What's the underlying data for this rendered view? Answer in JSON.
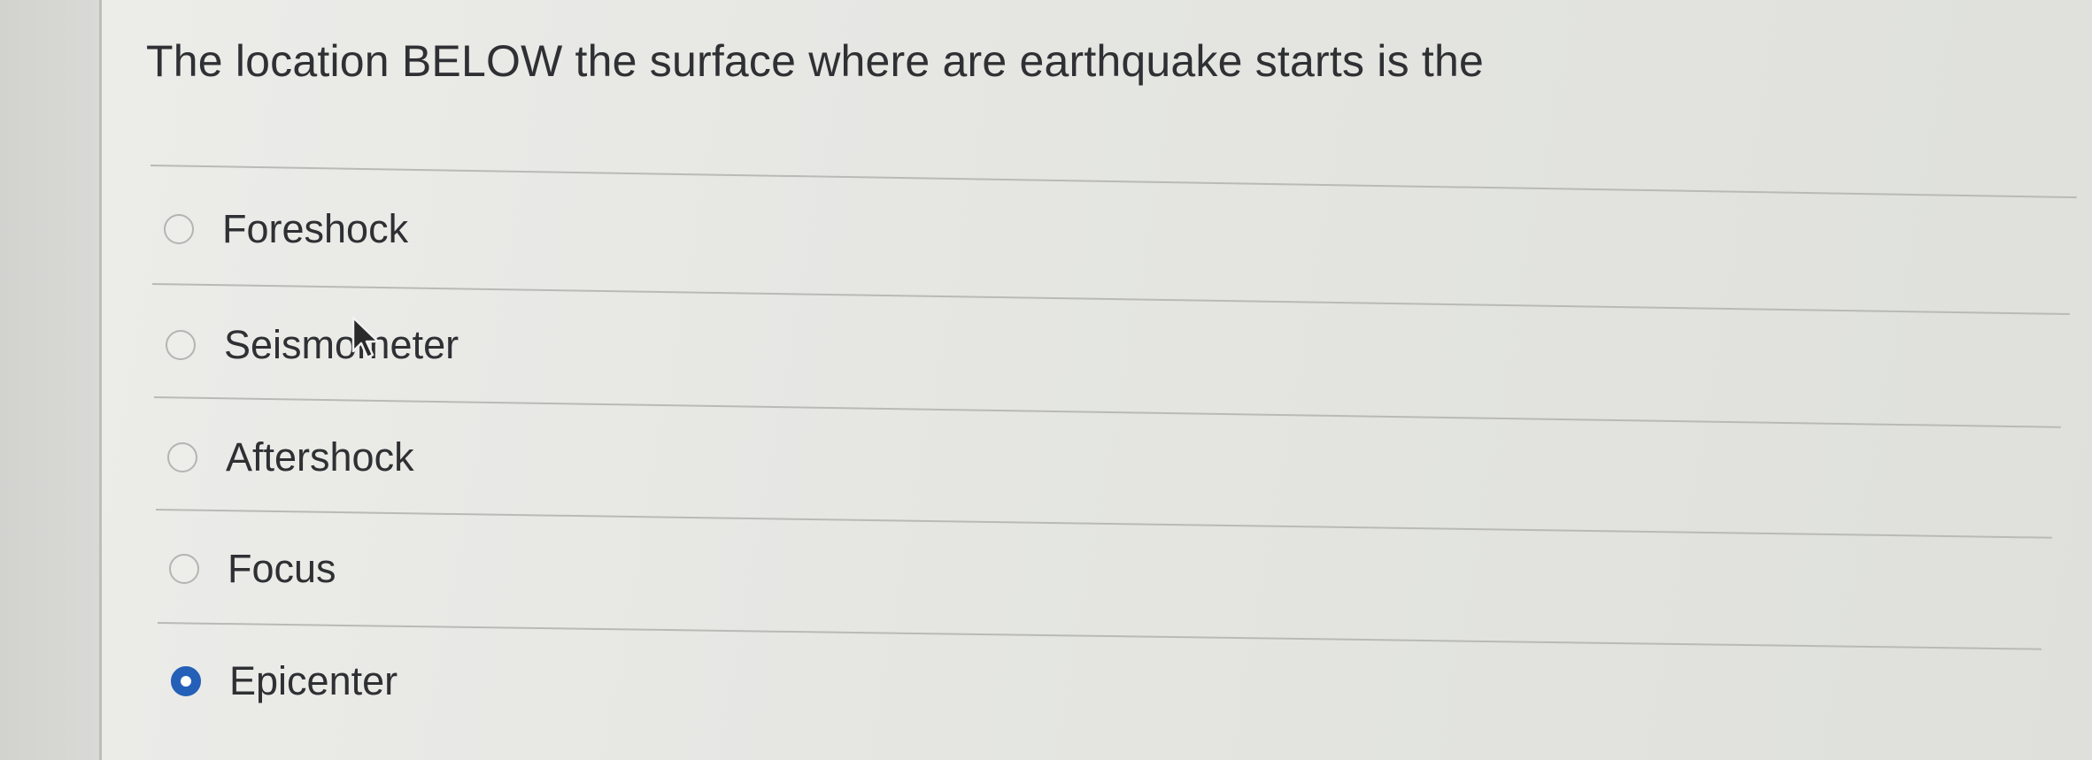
{
  "question": {
    "text": "The location BELOW the surface where are earthquake starts is the"
  },
  "options": [
    {
      "label": "Foreshock",
      "selected": false
    },
    {
      "label": "Seismometer",
      "selected": false
    },
    {
      "label": "Aftershock",
      "selected": false
    },
    {
      "label": "Focus",
      "selected": false
    },
    {
      "label": "Epicenter",
      "selected": true
    }
  ],
  "colors": {
    "selected_radio": "#2460b8",
    "text": "#2f3033"
  }
}
